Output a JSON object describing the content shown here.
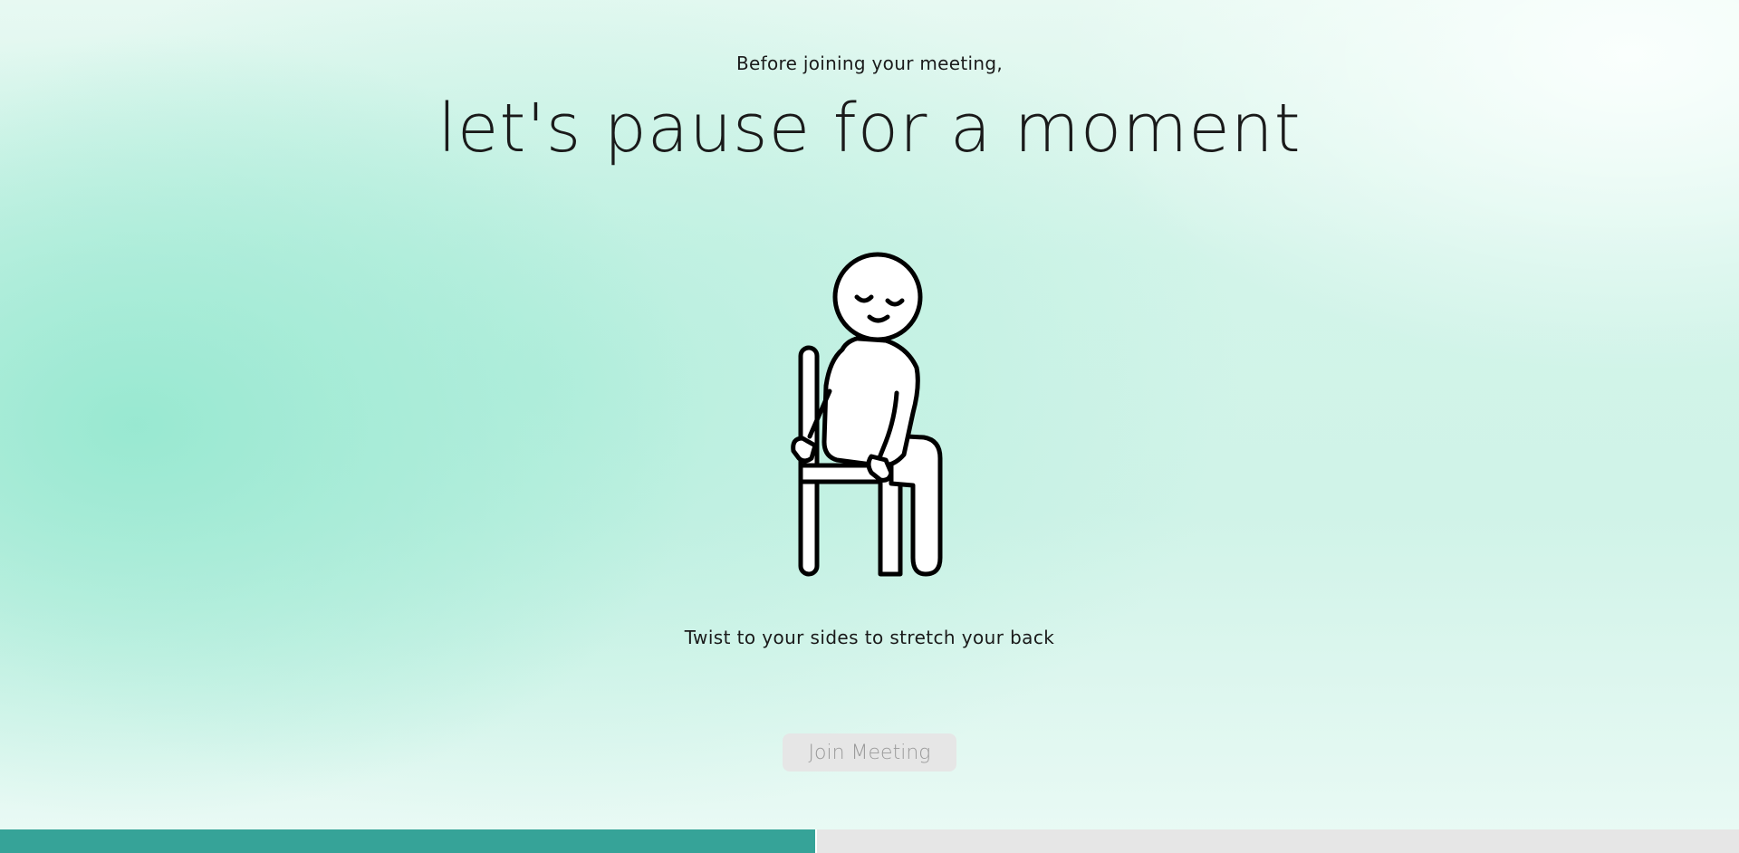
{
  "header": {
    "subtitle": "Before joining your meeting,",
    "headline": "let's pause for a moment"
  },
  "exercise": {
    "illustration_icon": "person-seated-twist-icon",
    "instruction": "Twist to your sides to stretch your back"
  },
  "actions": {
    "join_label": "Join Meeting",
    "join_enabled": false
  },
  "progress": {
    "fraction": 0.47,
    "fill_color": "#36a398",
    "track_color": "#e6e6e6"
  },
  "colors": {
    "background_accent": "#a8ecd8",
    "text": "#1a1a1a"
  }
}
